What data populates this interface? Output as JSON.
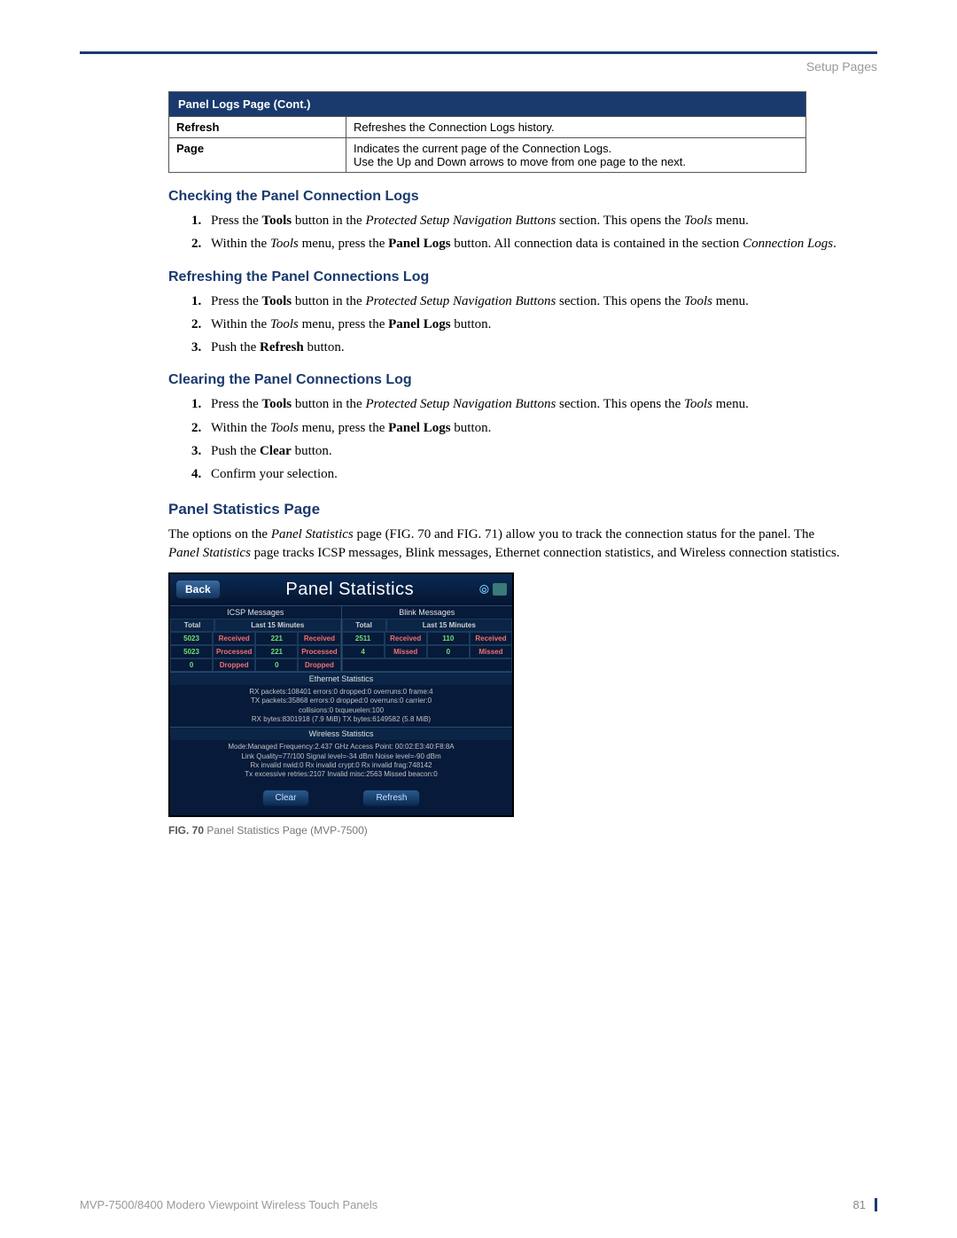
{
  "header": {
    "section": "Setup Pages"
  },
  "panelLogsTable": {
    "title": "Panel Logs Page (Cont.)",
    "rows": [
      {
        "label": "Refresh",
        "desc": "Refreshes the Connection Logs history."
      },
      {
        "label": "Page",
        "desc": "Indicates the current page of the Connection Logs.\nUse the Up and Down arrows to move from one page to the next."
      }
    ]
  },
  "sections": {
    "s1": {
      "title": "Checking the Panel Connection Logs",
      "steps": [
        [
          [
            "t",
            "Press the "
          ],
          [
            "b",
            "Tools"
          ],
          [
            "t",
            " button in the "
          ],
          [
            "i",
            "Protected Setup Navigation Buttons"
          ],
          [
            "t",
            " section. This opens the "
          ],
          [
            "i",
            "Tools"
          ],
          [
            "t",
            " menu."
          ]
        ],
        [
          [
            "t",
            "Within the "
          ],
          [
            "i",
            "Tools"
          ],
          [
            "t",
            " menu, press the "
          ],
          [
            "b",
            "Panel Logs"
          ],
          [
            "t",
            " button. All connection data is contained in the section "
          ],
          [
            "i",
            "Connection Logs"
          ],
          [
            "t",
            "."
          ]
        ]
      ]
    },
    "s2": {
      "title": "Refreshing the Panel Connections Log",
      "steps": [
        [
          [
            "t",
            "Press the "
          ],
          [
            "b",
            "Tools"
          ],
          [
            "t",
            " button in the "
          ],
          [
            "i",
            "Protected Setup Navigation Buttons"
          ],
          [
            "t",
            " section. This opens the "
          ],
          [
            "i",
            "Tools"
          ],
          [
            "t",
            " menu."
          ]
        ],
        [
          [
            "t",
            "Within the "
          ],
          [
            "i",
            "Tools"
          ],
          [
            "t",
            " menu, press the "
          ],
          [
            "b",
            "Panel Logs"
          ],
          [
            "t",
            " button."
          ]
        ],
        [
          [
            "t",
            "Push the "
          ],
          [
            "b",
            "Refresh"
          ],
          [
            "t",
            " button."
          ]
        ]
      ]
    },
    "s3": {
      "title": "Clearing the Panel Connections Log",
      "steps": [
        [
          [
            "t",
            "Press the "
          ],
          [
            "b",
            "Tools"
          ],
          [
            "t",
            " button in the "
          ],
          [
            "i",
            "Protected Setup Navigation Buttons"
          ],
          [
            "t",
            " section. This opens the "
          ],
          [
            "i",
            "Tools"
          ],
          [
            "t",
            " menu."
          ]
        ],
        [
          [
            "t",
            "Within the "
          ],
          [
            "i",
            "Tools"
          ],
          [
            "t",
            " menu, press the "
          ],
          [
            "b",
            "Panel Logs"
          ],
          [
            "t",
            " button."
          ]
        ],
        [
          [
            "t",
            "Push the "
          ],
          [
            "b",
            "Clear"
          ],
          [
            "t",
            " button."
          ]
        ],
        [
          [
            "t",
            "Confirm your selection."
          ]
        ]
      ]
    },
    "s4": {
      "title": "Panel Statistics Page",
      "intro": [
        [
          "t",
          "The options on the "
        ],
        [
          "i",
          "Panel Statistics"
        ],
        [
          "t",
          " page (FIG. 70 and FIG. 71) allow you to track the connection status for the panel. The "
        ],
        [
          "i",
          "Panel Statistics"
        ],
        [
          "t",
          " page tracks ICSP messages, Blink messages, Ethernet connection statistics, and Wireless connection statistics."
        ]
      ]
    }
  },
  "panelStats": {
    "back": "Back",
    "title": "Panel Statistics",
    "icsp": {
      "header": "ICSP Messages",
      "totalHdr": "Total",
      "last15": "Last 15 Minutes",
      "r1": {
        "v1": "5023",
        "l1": "Received",
        "v2": "221",
        "l2": "Received"
      },
      "r2": {
        "v1": "5023",
        "l1": "Processed",
        "v2": "221",
        "l2": "Processed"
      },
      "r3": {
        "v1": "0",
        "l1": "Dropped",
        "v2": "0",
        "l2": "Dropped"
      }
    },
    "blink": {
      "header": "Blink Messages",
      "totalHdr": "Total",
      "last15": "Last 15 Minutes",
      "r1": {
        "v1": "2511",
        "l1": "Received",
        "v2": "110",
        "l2": "Received"
      },
      "r2": {
        "v1": "4",
        "l1": "Missed",
        "v2": "0",
        "l2": "Missed"
      }
    },
    "eth": {
      "header": "Ethernet Statistics",
      "l1": "RX packets:108401 errors:0 dropped:0 overruns:0 frame:4",
      "l2": "TX packets:35868 errors:0 dropped:0 overruns:0 carrier:0",
      "l3": "collisions:0 txqueuelen:100",
      "l4": "RX bytes:8301918 (7.9 MiB)  TX bytes:6149582 (5.8 MiB)"
    },
    "wifi": {
      "header": "Wireless Statistics",
      "l1": "Mode:Managed  Frequency:2.437 GHz  Access Point: 00:02:E3:40:F8:8A",
      "l2": "Link Quality=77/100  Signal level=-34 dBm  Noise level=-90 dBm",
      "l3": "Rx invalid nwid:0  Rx invalid crypt:0  Rx invalid frag:748142",
      "l4": "Tx excessive retries:2107  Invalid misc:2563   Missed beacon:0"
    },
    "clearBtn": "Clear",
    "refreshBtn": "Refresh"
  },
  "figCaption": {
    "prefix": "FIG. 70",
    "text": "  Panel Statistics Page (MVP-7500)"
  },
  "footer": {
    "doc": "MVP-7500/8400 Modero Viewpoint Wireless Touch Panels",
    "page": "81"
  }
}
